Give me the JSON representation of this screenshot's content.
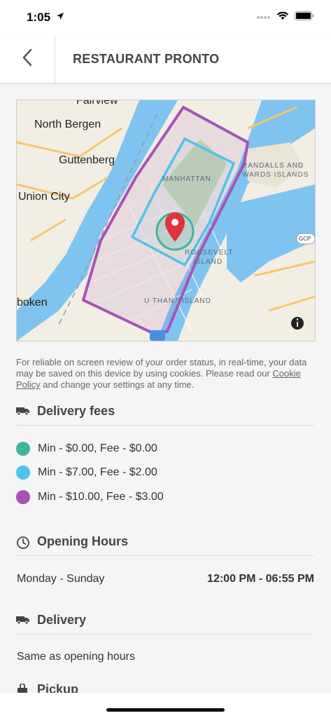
{
  "status_bar": {
    "time": "1:05"
  },
  "header": {
    "title": "RESTAURANT PRONTO"
  },
  "map": {
    "labels": [
      "Fairview",
      "North Bergen",
      "Guttenberg",
      "Union City",
      "boken"
    ],
    "small_labels": [
      "MANHATTAN",
      "RANDALLS AND",
      "WARDS ISLANDS",
      "ROOSEVELT",
      "ISLAND",
      "U THANT ISLAND"
    ],
    "road_badge": "GCP",
    "zone_colors": {
      "min0": "#3fb598",
      "min7": "#4fc3e8",
      "min10": "#a454b8"
    }
  },
  "cookie": {
    "text_before": "For reliable on screen review of your order status, in real-time, your data may be saved on this device by using cookies. Please read our ",
    "link": "Cookie Policy",
    "text_after": " and change your settings at any time."
  },
  "delivery_fees": {
    "title": "Delivery fees",
    "items": [
      {
        "label": "Min - $0.00, Fee - $0.00",
        "color": "#3fb598"
      },
      {
        "label": "Min - $7.00, Fee - $2.00",
        "color": "#4fc3e8"
      },
      {
        "label": "Min - $10.00, Fee - $3.00",
        "color": "#a454b8"
      }
    ]
  },
  "opening_hours": {
    "title": "Opening Hours",
    "day": "Monday - Sunday",
    "time": "12:00 PM - 06:55 PM"
  },
  "delivery": {
    "title": "Delivery",
    "text": "Same as opening hours"
  },
  "pickup": {
    "title": "Pickup"
  }
}
